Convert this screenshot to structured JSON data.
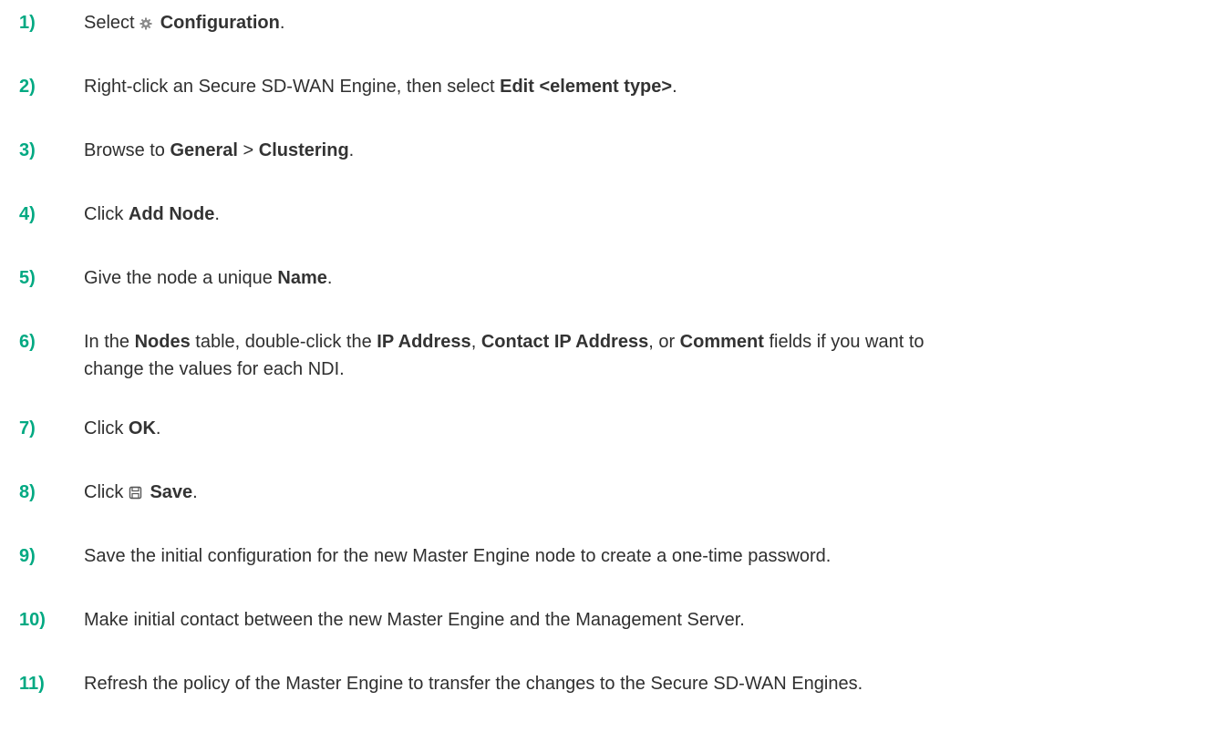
{
  "steps": [
    {
      "num": "1)",
      "parts": [
        {
          "t": "Select "
        },
        {
          "icon": "gear-icon"
        },
        {
          "t": " "
        },
        {
          "b": "Configuration"
        },
        {
          "t": "."
        }
      ]
    },
    {
      "num": "2)",
      "parts": [
        {
          "t": "Right-click an Secure SD-WAN Engine, then select "
        },
        {
          "b": "Edit <element type>"
        },
        {
          "t": "."
        }
      ]
    },
    {
      "num": "3)",
      "parts": [
        {
          "t": "Browse to "
        },
        {
          "b": "General"
        },
        {
          "t": " > "
        },
        {
          "b": "Clustering"
        },
        {
          "t": "."
        }
      ]
    },
    {
      "num": "4)",
      "parts": [
        {
          "t": "Click "
        },
        {
          "b": "Add Node"
        },
        {
          "t": "."
        }
      ]
    },
    {
      "num": "5)",
      "parts": [
        {
          "t": "Give the node a unique "
        },
        {
          "b": "Name"
        },
        {
          "t": "."
        }
      ]
    },
    {
      "num": "6)",
      "parts": [
        {
          "t": "In the "
        },
        {
          "b": "Nodes"
        },
        {
          "t": " table, double-click the "
        },
        {
          "b": "IP Address"
        },
        {
          "t": ", "
        },
        {
          "b": "Contact IP Address"
        },
        {
          "t": ", or "
        },
        {
          "b": "Comment"
        },
        {
          "t": " fields if you want to"
        },
        {
          "br": true
        },
        {
          "t": "change the values for each NDI."
        }
      ]
    },
    {
      "num": "7)",
      "parts": [
        {
          "t": "Click "
        },
        {
          "b": "OK"
        },
        {
          "t": "."
        }
      ]
    },
    {
      "num": "8)",
      "parts": [
        {
          "t": "Click "
        },
        {
          "icon": "save-icon"
        },
        {
          "t": " "
        },
        {
          "b": "Save"
        },
        {
          "t": "."
        }
      ]
    },
    {
      "num": "9)",
      "parts": [
        {
          "t": "Save the initial configuration for the new Master Engine node to create a one-time password."
        }
      ]
    },
    {
      "num": "10)",
      "parts": [
        {
          "t": "Make initial contact between the new Master Engine and the Management Server."
        }
      ]
    },
    {
      "num": "11)",
      "parts": [
        {
          "t": "Refresh the policy of the Master Engine to transfer the changes to the Secure SD-WAN Engines."
        }
      ]
    }
  ],
  "colors": {
    "step_number": "#01a982",
    "text": "#2f2f2f",
    "icon": "#8a8a8a"
  }
}
